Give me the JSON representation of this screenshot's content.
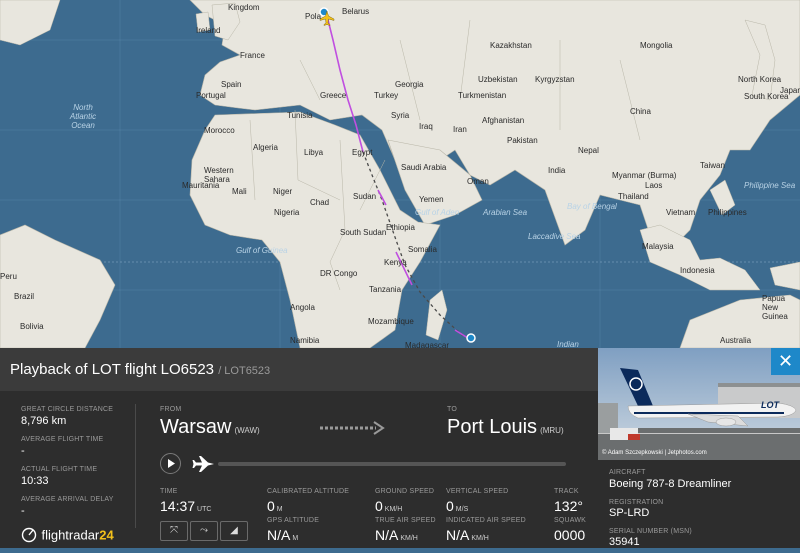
{
  "map": {
    "labels": {
      "kingdom": "Kingdom",
      "belarus": "Belarus",
      "poland": "Pola",
      "ireland": "Ireland",
      "kazakhstan": "Kazakhstan",
      "mongolia": "Mongolia",
      "france": "France",
      "uzbekistan": "Uzbekistan",
      "kyrgyzstan": "Kyrgyzstan",
      "spain": "Spain",
      "georgia": "Georgia",
      "turkmenistan": "Turkmenistan",
      "portugal": "Portugal",
      "greece": "Greece",
      "turkey": "Turkey",
      "north_korea": "North Korea",
      "south_korea": "South Korea",
      "japan": "Japan",
      "north_atlantic_ocean": "North Atlantic Ocean",
      "tunisia": "Tunisia",
      "syria": "Syria",
      "afghanistan": "Afghanistan",
      "china": "China",
      "morocco": "Morocco",
      "iraq": "Iraq",
      "iran": "Iran",
      "algeria": "Algeria",
      "libya": "Libya",
      "egypt": "Egypt",
      "pakistan": "Pakistan",
      "nepal": "Nepal",
      "western_sahara": "Western Sahara",
      "saudi_arabia": "Saudi Arabia",
      "india": "India",
      "myanmar": "Myanmar (Burma)",
      "taiwan": "Taiwan",
      "mauritania": "Mauritania",
      "mali": "Mali",
      "niger": "Niger",
      "oman": "Oman",
      "laos": "Laos",
      "chad": "Chad",
      "sudan": "Sudan",
      "yemen": "Yemen",
      "thailand": "Thailand",
      "philippine_sea": "Philippine Sea",
      "gulf_of_aden": "Gulf of Aden",
      "arabian_sea": "Arabian Sea",
      "bay_of_bengal": "Bay of Bengal",
      "vietnam": "Vietnam",
      "philippines": "Philippines",
      "nigeria": "Nigeria",
      "south_sudan": "South Sudan",
      "ethiopia": "Ethiopia",
      "somalia": "Somalia",
      "laccadive_sea": "Laccadive Sea",
      "malaysia": "Malaysia",
      "gulf_of_guinea": "Gulf of Guinea",
      "dr_congo": "DR Congo",
      "kenya": "Kenya",
      "indonesia": "Indonesia",
      "tanzania": "Tanzania",
      "peru": "Peru",
      "brazil": "Brazil",
      "angola": "Angola",
      "mozambique": "Mozambique",
      "bolivia": "Bolivia",
      "namibia": "Namibia",
      "madagascar": "Madagascar",
      "papua_new_guinea": "Papua New Guinea",
      "indian": "Indian",
      "australia": "Australia"
    }
  },
  "panel": {
    "title": "Playback of LOT flight LO6523",
    "callsign": "/ LOT6523",
    "stats": {
      "gcd_label": "GREAT CIRCLE DISTANCE",
      "gcd_value": "8,796 km",
      "aft_label": "AVERAGE FLIGHT TIME",
      "aft_value": "-",
      "act_label": "ACTUAL FLIGHT TIME",
      "act_value": "10:33",
      "aad_label": "AVERAGE ARRIVAL DELAY",
      "aad_value": "-"
    },
    "route": {
      "from_label": "FROM",
      "from_city": "Warsaw",
      "from_code": "(WAW)",
      "to_label": "TO",
      "to_city": "Port Louis",
      "to_code": "(MRU)"
    },
    "telemetry": {
      "time_label": "TIME",
      "time_value": "14:37",
      "time_unit": "UTC",
      "cal_alt_label": "CALIBRATED ALTITUDE",
      "cal_alt_value": "0",
      "cal_alt_unit": "M",
      "gps_alt_label": "GPS ALTITUDE",
      "gps_alt_value": "N/A",
      "gps_alt_unit": "M",
      "gs_label": "GROUND SPEED",
      "gs_value": "0",
      "gs_unit": "KM/H",
      "tas_label": "TRUE AIR SPEED",
      "tas_value": "N/A",
      "tas_unit": "KM/H",
      "vs_label": "VERTICAL SPEED",
      "vs_value": "0",
      "vs_unit": "M/S",
      "ias_label": "INDICATED AIR SPEED",
      "ias_value": "N/A",
      "ias_unit": "KM/H",
      "track_label": "TRACK",
      "track_value": "132°",
      "squawk_label": "SQUAWK",
      "squawk_value": "0000"
    },
    "buttons": {
      "expand_icon": "⤧",
      "route_icon": "⤳",
      "chart_icon": "◢"
    },
    "logo_text": "flightradar",
    "logo_num": "24"
  },
  "aircraft": {
    "photo_credit": "© Adam Szczepkowski | Jetphotos.com",
    "livery_text": "LOT",
    "aircraft_label": "AIRCRAFT",
    "aircraft_value": "Boeing 787-8 Dreamliner",
    "registration_label": "REGISTRATION",
    "registration_value": "SP-LRD",
    "msn_label": "SERIAL NUMBER (MSN)",
    "msn_value": "35941",
    "close_icon": "✕"
  },
  "colors": {
    "route": "#c04fe0",
    "accent": "#1e88c9",
    "panel": "#2d2d2d",
    "land": "#e8e6de",
    "water": "#3d6b8f"
  }
}
